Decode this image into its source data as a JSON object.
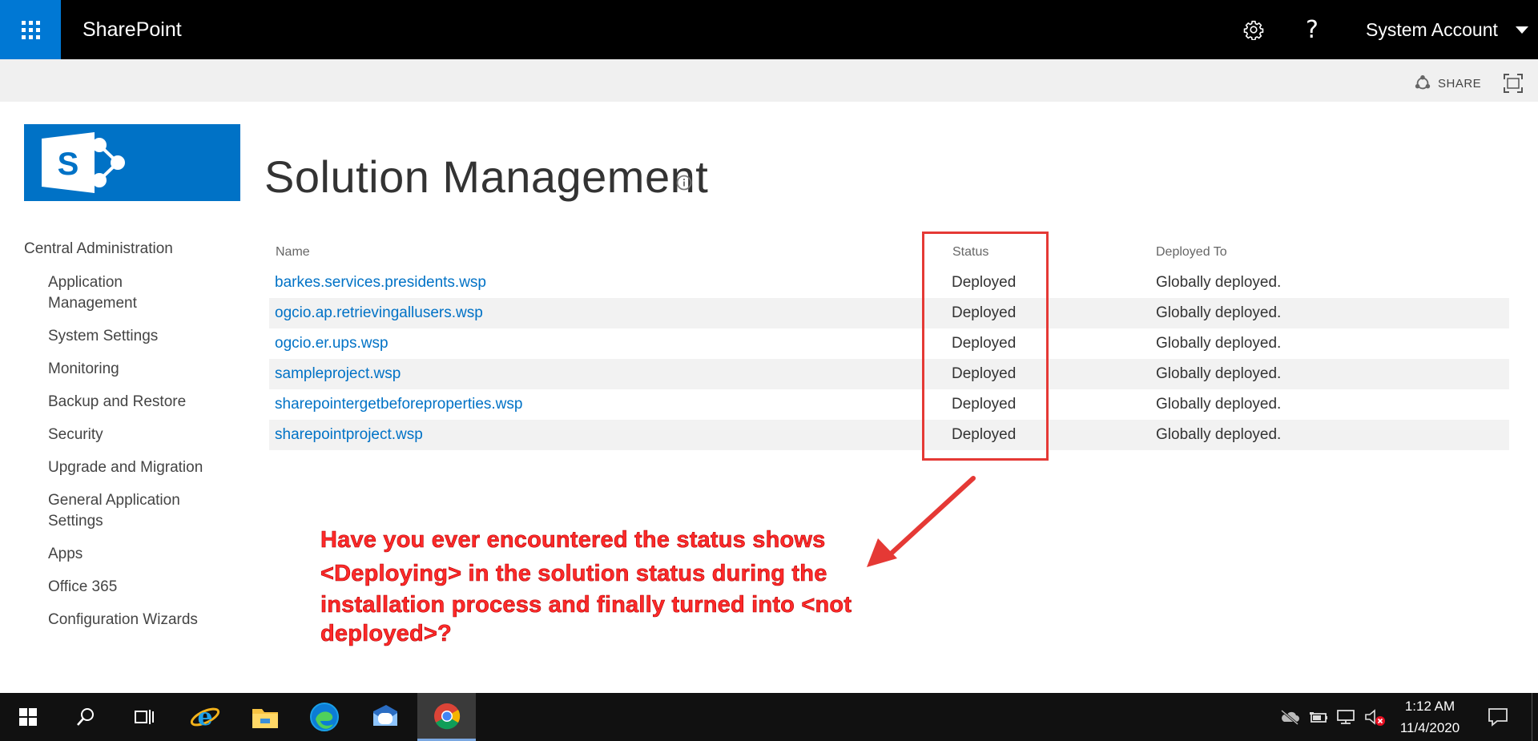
{
  "suitebar": {
    "app_name": "SharePoint",
    "account_name": "System Account",
    "icons": [
      "app-launcher-icon",
      "gear-icon",
      "help-icon",
      "chevron-down-icon"
    ]
  },
  "ribbon": {
    "share_label": "SHARE"
  },
  "page": {
    "title": "Solution Management"
  },
  "nav": {
    "root": "Central Administration",
    "items": [
      "Application Management",
      "System Settings",
      "Monitoring",
      "Backup and Restore",
      "Security",
      "Upgrade and Migration",
      "General Application Settings",
      "Apps",
      "Office 365",
      "Configuration Wizards"
    ]
  },
  "table": {
    "columns": [
      "Name",
      "Status",
      "Deployed To"
    ],
    "rows": [
      {
        "name": "barkes.services.presidents.wsp",
        "status": "Deployed",
        "deployed_to": "Globally deployed."
      },
      {
        "name": "ogcio.ap.retrievingallusers.wsp",
        "status": "Deployed",
        "deployed_to": "Globally deployed."
      },
      {
        "name": "ogcio.er.ups.wsp",
        "status": "Deployed",
        "deployed_to": "Globally deployed."
      },
      {
        "name": "sampleproject.wsp",
        "status": "Deployed",
        "deployed_to": "Globally deployed."
      },
      {
        "name": "sharepointergetbeforeproperties.wsp",
        "status": "Deployed",
        "deployed_to": "Globally deployed."
      },
      {
        "name": "sharepointproject.wsp",
        "status": "Deployed",
        "deployed_to": "Globally deployed."
      }
    ]
  },
  "annotation": {
    "lines": [
      "Have you ever encountered the status shows",
      "<Deploying> in the solution status during the",
      "installation process and finally turned into <not",
      "deployed>?"
    ],
    "color": "#ff2a2a"
  },
  "taskbar": {
    "time": "1:12 AM",
    "date": "11/4/2020"
  },
  "colors": {
    "suitebar": "#000000",
    "accent": "#0078d4",
    "link": "#0072c6",
    "annotation_red": "#e53935"
  }
}
